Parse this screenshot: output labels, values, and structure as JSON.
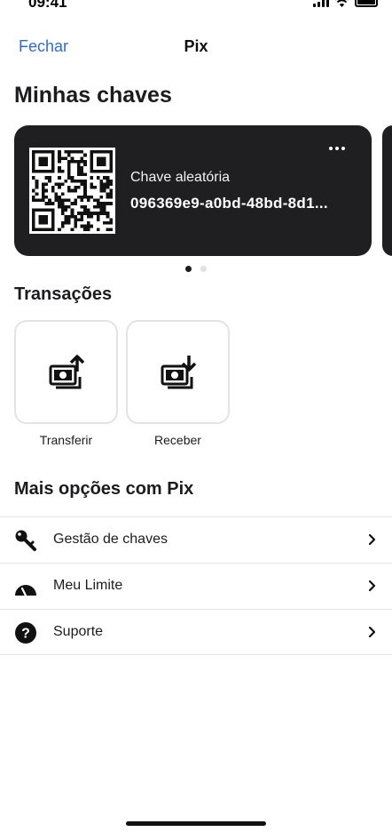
{
  "status_bar": {
    "time": "09:41"
  },
  "nav": {
    "close_label": "Fechar",
    "title": "Pix"
  },
  "keys_section": {
    "title": "Minhas chaves",
    "card": {
      "label": "Chave aleatória",
      "value": "096369e9-a0bd-48bd-8d1..."
    },
    "pagination": {
      "total": 2,
      "active": 1
    }
  },
  "transactions": {
    "title": "Transações",
    "actions": [
      {
        "label": "Transferir",
        "icon": "money-send-icon"
      },
      {
        "label": "Receber",
        "icon": "money-receive-icon"
      }
    ]
  },
  "more_options": {
    "title": "Mais opções com Pix",
    "items": [
      {
        "label": "Gestão de chaves",
        "icon": "key-icon"
      },
      {
        "label": "Meu Limite",
        "icon": "gauge-icon"
      },
      {
        "label": "Suporte",
        "icon": "question-icon"
      }
    ]
  },
  "colors": {
    "accent": "#2f6bd8",
    "card": "#1f1f21",
    "divider": "#e3e3e3"
  }
}
